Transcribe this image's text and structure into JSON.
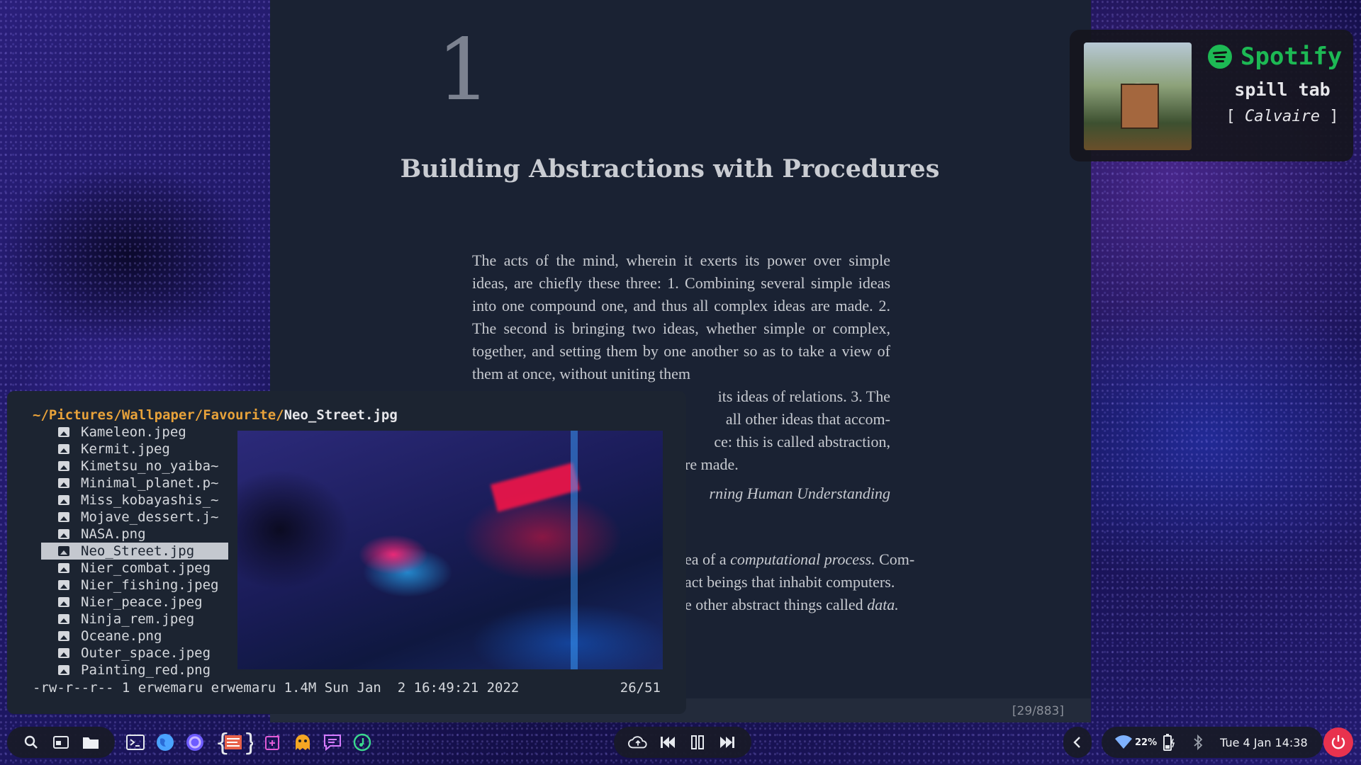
{
  "reader": {
    "chapter_number": "1",
    "chapter_title": "Building Abstractions with Procedures",
    "paragraph1": "The acts of the mind, wherein it exerts its power over simple ideas, are chiefly these three: 1. Combining several simple ideas into one compound one, and thus all complex ideas are made. 2. The second is bringing two ideas, whether simple or complex, together, and setting them by one another so as to take a view of them at once, without uniting them",
    "paragraph1_tail": "its ideas of relations. 3. The",
    "paragraph1_tail2": "all other ideas that accom-",
    "paragraph1_tail3": "ce: this is called abstraction,",
    "paragraph1_tail4": "re made.",
    "quote_source": "rning Human Understanding",
    "paragraph2_line1_prefix": "ea of a ",
    "paragraph2_line1_em": "computational process.",
    "paragraph2_line1_suffix": " Com-",
    "paragraph2_line2": "act beings that inhabit computers.",
    "paragraph2_line3_prefix": "e other abstract things called ",
    "paragraph2_line3_em": "data.",
    "page_counter": "[29/883]"
  },
  "spotify": {
    "brand": "Spotify",
    "track": "spill tab",
    "artist_open": "[",
    "artist": "Calvaire",
    "artist_close": "]",
    "accent": "#1db954"
  },
  "ranger": {
    "path_dir": "~/Pictures/Wallpaper/Favourite/",
    "path_file": "Neo_Street.jpg",
    "files": [
      {
        "name": "Kameleon.jpeg"
      },
      {
        "name": "Kermit.jpeg"
      },
      {
        "name": "Kimetsu_no_yaiba~"
      },
      {
        "name": "Minimal_planet.p~"
      },
      {
        "name": "Miss_kobayashis_~"
      },
      {
        "name": "Mojave_dessert.j~"
      },
      {
        "name": "NASA.png"
      },
      {
        "name": "Neo_Street.jpg"
      },
      {
        "name": "Nier_combat.jpeg"
      },
      {
        "name": "Nier_fishing.jpeg"
      },
      {
        "name": "Nier_peace.jpeg"
      },
      {
        "name": "Ninja_rem.jpeg"
      },
      {
        "name": "Oceane.png"
      },
      {
        "name": "Outer_space.jpeg"
      },
      {
        "name": "Painting_red.png"
      }
    ],
    "file_info": "-rw-r--r-- 1 erwemaru erwemaru 1.4M Sun Jan  2 16:49:21 2022",
    "position": "26/51",
    "dir_color": "#e8a23a"
  },
  "taskbar": {
    "left_icons": [
      "search-icon",
      "window-icon",
      "folder-icon"
    ],
    "apps": [
      "terminal-icon",
      "browser-icon",
      "firefox-icon",
      "code-editor-icon",
      "notes-icon",
      "ghost-icon",
      "chat-icon",
      "music-icon"
    ],
    "media": [
      "cloud-icon",
      "previous-icon",
      "pause-icon",
      "next-icon"
    ],
    "battery": "22%",
    "clock": "Tue  4 Jan 14:38",
    "power_color": "#e8324e"
  }
}
